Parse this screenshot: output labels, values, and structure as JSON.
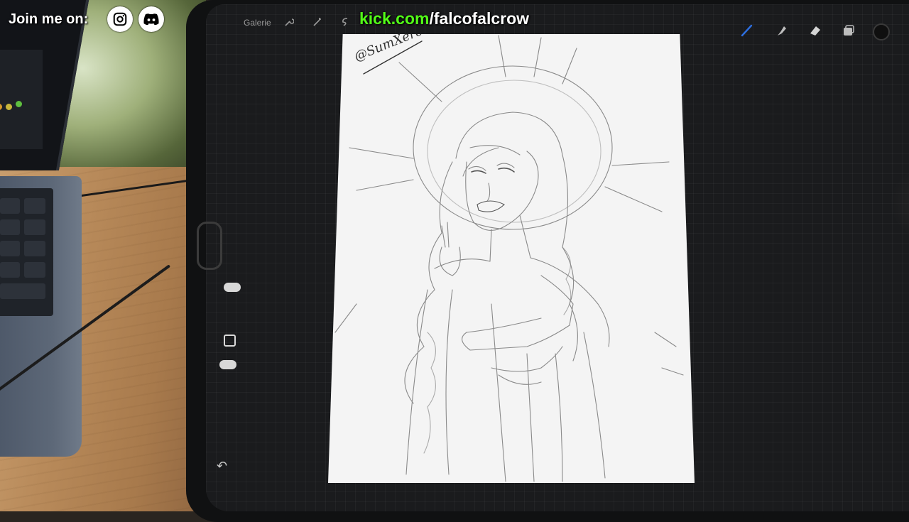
{
  "overlay": {
    "join_text": "Join me on:",
    "kick_domain": "kick.com",
    "kick_path": "/falcofalcrow",
    "kick_color": "#53fc18"
  },
  "procreate": {
    "gallery_label": "Galerie",
    "toolbar_left_icons": [
      "wrench-icon",
      "magic-wand-icon",
      "selection-icon"
    ],
    "toolbar_right_icons": [
      "brush-icon",
      "smudge-icon",
      "eraser-icon",
      "layers-icon",
      "color-icon"
    ],
    "active_tool": "brush",
    "active_tool_color": "#2d6fe0",
    "current_color": "#0f0f0f"
  },
  "artwork": {
    "signature": "@SumXeroina"
  }
}
